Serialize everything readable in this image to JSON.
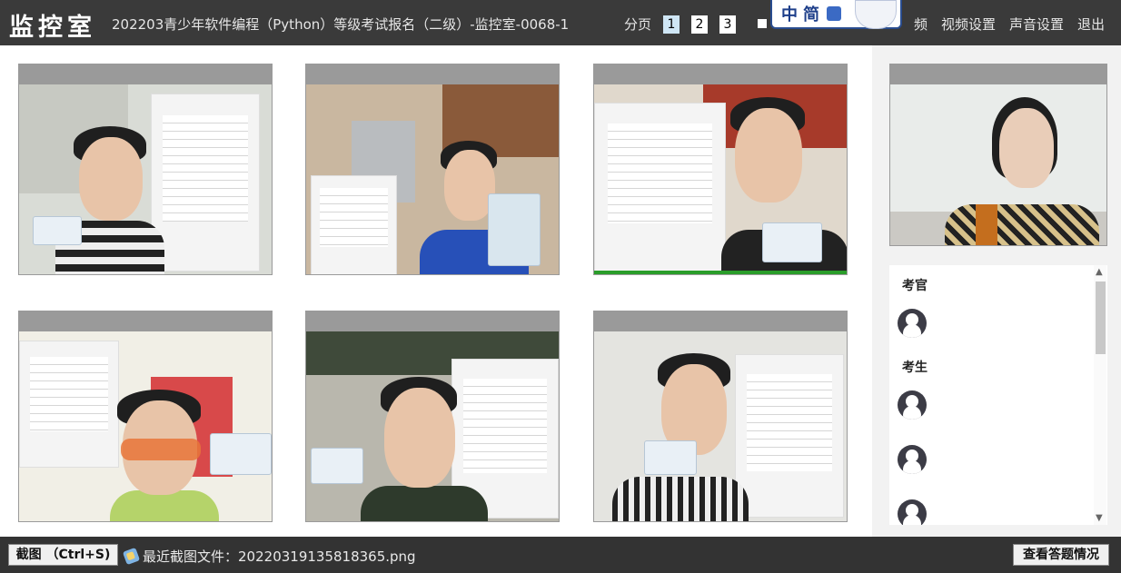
{
  "header": {
    "brand": "监控室",
    "exam_title": "202203青少年软件编程（Python）等级考试报名（二级）-监控室-0068-1",
    "pagination_label": "分页",
    "pages": [
      "1",
      "2",
      "3"
    ],
    "current_page": "1",
    "links": [
      "频",
      "视频设置",
      "声音设置",
      "退出"
    ]
  },
  "ime": {
    "label": "中简"
  },
  "sidebar": {
    "groups": [
      {
        "title": "考官",
        "avatar_count": 1
      },
      {
        "title": "考生",
        "avatar_count": 3
      }
    ]
  },
  "footer": {
    "screenshot_button": "截图 （Ctrl+S)",
    "last_screenshot_label": "最近截图文件：",
    "last_screenshot_file": "20220319135818365.png",
    "view_answers_button": "查看答题情况"
  },
  "colors": {
    "topbar": "#3a3a3a",
    "tile_header": "#9a9a9a",
    "active_page": "#cfe6f5",
    "footer": "#333333"
  }
}
